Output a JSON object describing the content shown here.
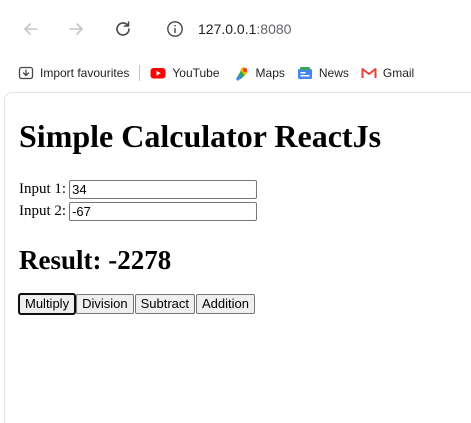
{
  "browser": {
    "url_host": "127.0.0.1",
    "url_port": ":8080",
    "bookmarks": [
      {
        "label": "Import favourites",
        "icon": "import-icon"
      },
      {
        "label": "YouTube",
        "icon": "youtube-icon"
      },
      {
        "label": "Maps",
        "icon": "maps-icon"
      },
      {
        "label": "News",
        "icon": "news-icon"
      },
      {
        "label": "Gmail",
        "icon": "gmail-icon"
      }
    ]
  },
  "page": {
    "title": "Simple Calculator ReactJs",
    "input1_label": "Input 1:",
    "input1_value": "34",
    "input2_label": "Input 2:",
    "input2_value": "-67",
    "result_text": "Result: -2278",
    "buttons": {
      "multiply": "Multiply",
      "division": "Division",
      "subtract": "Subtract",
      "addition": "Addition"
    }
  },
  "colors": {
    "youtube_red": "#ff0000",
    "gmail_red": "#ea4335",
    "button_bg": "#efefef"
  }
}
